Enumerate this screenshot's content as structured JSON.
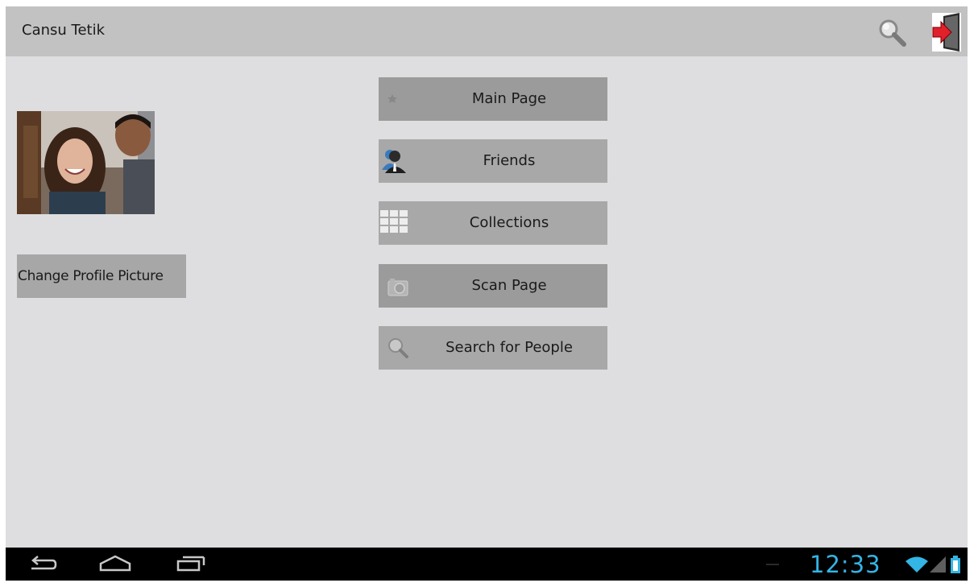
{
  "actionbar": {
    "title": "Cansu Tetik",
    "icons": [
      "search-icon",
      "logout-icon"
    ]
  },
  "profile": {
    "photo": "profile-photo",
    "change_picture_label": "Change Profile Picture"
  },
  "menu": [
    {
      "label": "Main Page",
      "icon": "star-icon"
    },
    {
      "label": "Friends",
      "icon": "person-icon"
    },
    {
      "label": "Collections",
      "icon": "grid-icon"
    },
    {
      "label": "Scan Page",
      "icon": "camera-icon"
    },
    {
      "label": "Search for People",
      "icon": "search-icon"
    }
  ],
  "statusbar": {
    "time": "12:33",
    "icons": [
      "wifi-icon",
      "signal-icon",
      "battery-icon"
    ]
  },
  "navbar": {
    "icons": [
      "back-icon",
      "home-icon",
      "recent-apps-icon"
    ]
  },
  "colors": {
    "accent": "#33b5e5",
    "background": "#dedee0",
    "actionbar": "#c2c2c2",
    "button": "#a8a8a8"
  }
}
